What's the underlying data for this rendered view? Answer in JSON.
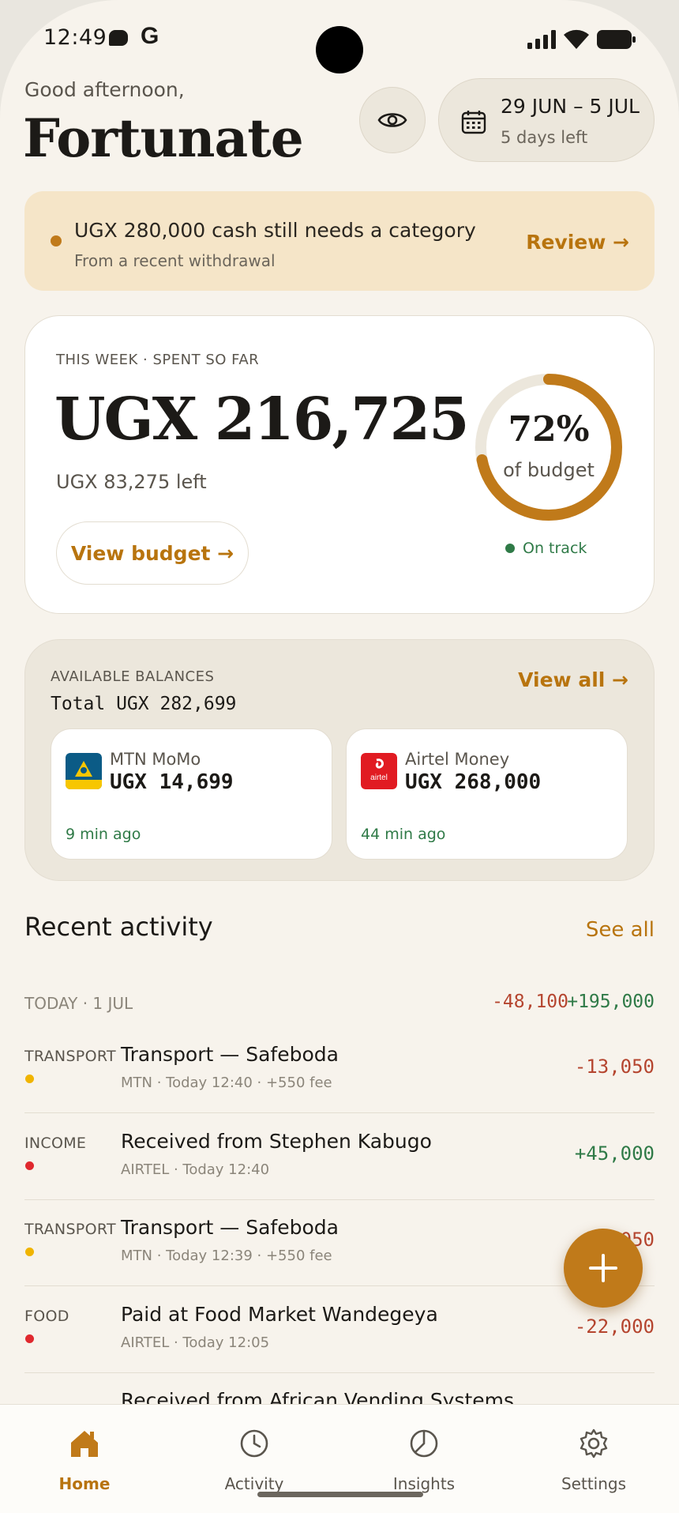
{
  "status_bar": {
    "time": "12:49",
    "g_label": "G"
  },
  "header": {
    "greeting": "Good afternoon,",
    "user_name": "Fortunate",
    "date_range": "29 JUN – 5 JUL",
    "days_left": "5 days left"
  },
  "banner": {
    "title": "UGX 280,000 cash still needs a category",
    "subtitle": "From a recent withdrawal",
    "action": "Review →"
  },
  "spent": {
    "eyebrow": "THIS WEEK · SPENT SO FAR",
    "amount": "UGX 216,725",
    "left": "UGX 83,275 left",
    "button": "View budget →",
    "percent_label": "72%",
    "percent_value": 0.72,
    "percent_sub": "of budget",
    "status": "On track",
    "ring_color": "#c07a1a"
  },
  "balances": {
    "eyebrow": "AVAILABLE BALANCES",
    "total": "Total UGX 282,699",
    "view_all": "View all →",
    "wallets": [
      {
        "name": "MTN MoMo",
        "amount": "UGX 14,699",
        "updated": "9 min ago",
        "logo_color": "#0b5b86"
      },
      {
        "name": "Airtel Money",
        "amount": "UGX 268,000",
        "updated": "44 min ago",
        "logo_color": "#e11b22",
        "logo_text": "airtel"
      }
    ]
  },
  "activity": {
    "title": "Recent activity",
    "see_all": "See all",
    "day_label": "TODAY · 1 JUL",
    "day_out": "-48,100",
    "day_in": "+195,000",
    "transactions": [
      {
        "category": "TRANSPORT",
        "dot_color": "#f0b400",
        "title": "Transport — Safeboda",
        "meta": "MTN · Today 12:40 · +550 fee",
        "amount": "-13,050"
      },
      {
        "category": "INCOME",
        "dot_color": "#e0282e",
        "title": "Received from Stephen Kabugo",
        "meta": "AIRTEL · Today 12:40",
        "amount": "+45,000"
      },
      {
        "category": "TRANSPORT",
        "dot_color": "#f0b400",
        "title": "Transport — Safeboda",
        "meta": "MTN · Today 12:39 · +550 fee",
        "amount": "-13,050"
      },
      {
        "category": "FOOD",
        "dot_color": "#e0282e",
        "title": "Paid at Food Market Wandegeya",
        "meta": "AIRTEL · Today 12:05",
        "amount": "-22,000"
      },
      {
        "category": "",
        "dot_color": "",
        "title": "Received from African Vending Systems",
        "meta": "",
        "amount": ""
      }
    ]
  },
  "nav": {
    "items": [
      {
        "label": "Home",
        "icon": "home-icon",
        "active": true
      },
      {
        "label": "Activity",
        "icon": "clock-icon",
        "active": false
      },
      {
        "label": "Insights",
        "icon": "pie-chart-icon",
        "active": false
      },
      {
        "label": "Settings",
        "icon": "gear-icon",
        "active": false
      }
    ]
  }
}
